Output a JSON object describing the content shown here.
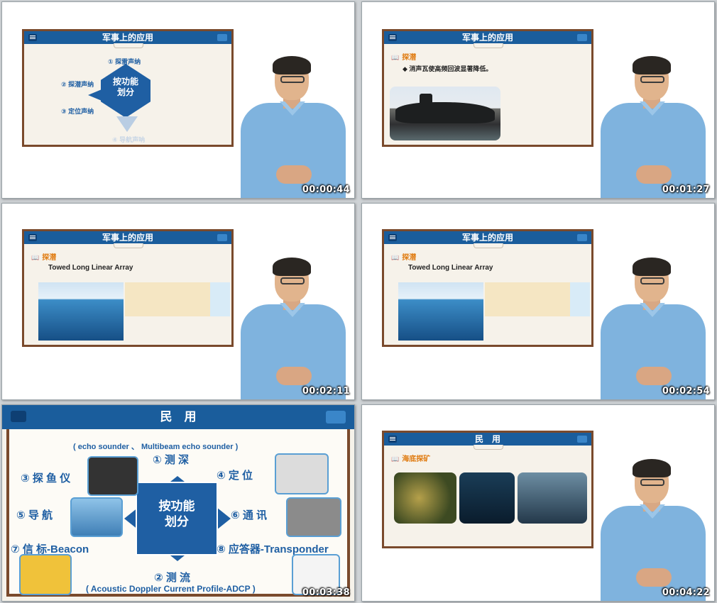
{
  "frames": [
    {
      "timestamp": "00:00:44",
      "header": "军事上的应用",
      "labels": [
        "① 探雷声纳",
        "② 探潜声纳",
        "③ 定位声纳",
        "④ 导航声呐"
      ],
      "center": "按功能\n划分"
    },
    {
      "timestamp": "00:01:27",
      "header": "军事上的应用",
      "section": "探潜",
      "bullet": "◆ 消声瓦使高频回波显著降低。"
    },
    {
      "timestamp": "00:02:11",
      "header": "军事上的应用",
      "section": "探潜",
      "subtitle": "Towed Long Linear Array"
    },
    {
      "timestamp": "00:02:54",
      "header": "军事上的应用",
      "section": "探潜",
      "subtitle": "Towed Long Linear Array"
    },
    {
      "timestamp": "00:03:38",
      "header": "民　用",
      "top_note": "( echo sounder 、 Multibeam echo sounder )",
      "center": "按功能\n划分",
      "items": {
        "depth": "① 测 深",
        "flow": "② 测 流",
        "fishfinder": "③ 探 鱼 仪",
        "position": "④ 定 位",
        "navigation": "⑤ 导 航",
        "communication": "⑥ 通 讯",
        "beacon": "⑦ 信 标-Beacon",
        "transponder": "⑧ 应答器-Transponder"
      },
      "bottom_note": "( Acoustic Doppler Current Profile-ADCP )"
    },
    {
      "timestamp": "00:04:22",
      "header": "民　用",
      "section": "海底探矿"
    }
  ],
  "colors": {
    "header_blue": "#1a5d9c",
    "accent_orange": "#e07b10",
    "slide_border": "#7a4a2c",
    "diagram_blue": "#1f5fa3",
    "shirt_blue": "#7fb3de"
  },
  "icons": [
    "menu-icon",
    "chat-icon",
    "book-icon"
  ]
}
